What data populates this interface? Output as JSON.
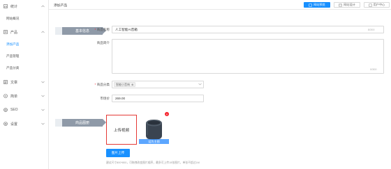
{
  "sidebar": {
    "groups": [
      {
        "label": "统计",
        "icon": "stats-icon",
        "open": true
      },
      {
        "label": "产品",
        "icon": "product-icon",
        "open": true
      },
      {
        "label": "文章",
        "icon": "article-icon",
        "open": false
      },
      {
        "label": "简单",
        "icon": "simple-icon",
        "open": false
      },
      {
        "label": "SEO",
        "icon": "seo-icon",
        "open": false
      },
      {
        "label": "设置",
        "icon": "settings-icon",
        "open": false
      }
    ],
    "subitems": {
      "stats_overview": "网站概况",
      "add_product": "添加产品",
      "product_manage": "产品管理",
      "product_category": "产品分类"
    }
  },
  "header": {
    "title": "添加产品",
    "buttons": [
      {
        "label": "网站预览",
        "icon": "preview-icon",
        "primary": true
      },
      {
        "label": "网站设计",
        "icon": "design-icon",
        "primary": false
      },
      {
        "label": "用户中心",
        "icon": "user-icon",
        "primary": false
      }
    ]
  },
  "form": {
    "basic_section": "基本信息",
    "media_section": "商品图册",
    "name_label": "商品名称",
    "name_value": "人工智能AI音箱",
    "name_counter": "8/300",
    "desc_label": "商品简介",
    "desc_counter": "0/300",
    "category_label": "商品分类",
    "category_tag": "智能小音响",
    "category_tag_close": "⊗",
    "price_label": "市场价",
    "price_value": "269.00",
    "upload_video": "上传视频",
    "thumb_banner": "设为主图",
    "thumb_close": "×",
    "upload_image_button": "图片上传",
    "hint": "建议尺寸800*800，可拖拽改变图片顺序，最多可上传15张图片，单张不超过1M"
  },
  "colors": {
    "accent": "#1890ff",
    "band": "#8f9aa8",
    "video_border": "#e53935"
  }
}
